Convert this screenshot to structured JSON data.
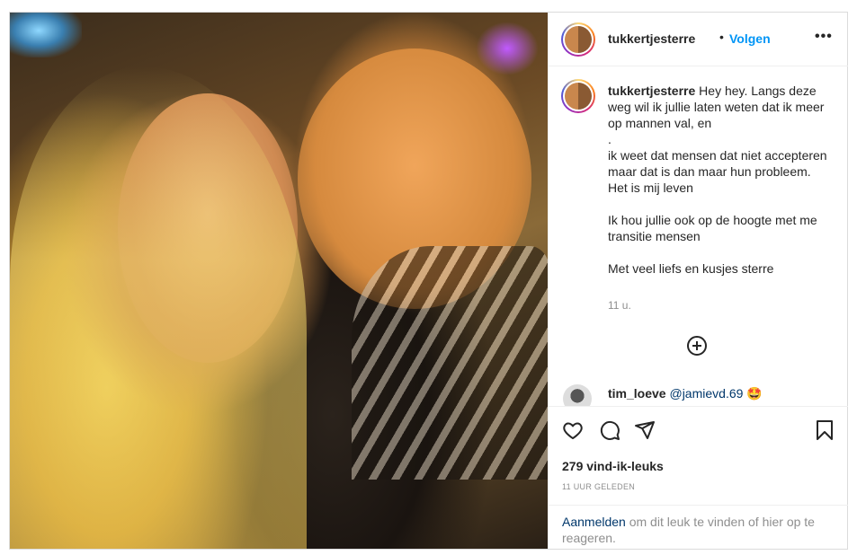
{
  "post": {
    "author": "tukkertjesterre",
    "separator": "•",
    "follow_label": "Volgen",
    "more_label": "•••",
    "caption_user": "tukkertjesterre",
    "caption_text": "Hey hey. Langs deze weg wil ik jullie laten weten dat ik meer op mannen val, en\n.\nik weet dat mensen dat niet accepteren maar dat is dan maar hun probleem.\nHet is mij leven\n\nIk hou jullie ook op de hoogte met me transitie mensen\n\nMet veel liefs en kusjes sterre",
    "caption_time": "11 u.",
    "comment": {
      "user": "tim_loeve",
      "mention": "@jamievd.69",
      "emoji": "🤩"
    },
    "likes": "279 vind-ik-leuks",
    "posted_ago": "11 UUR GELEDEN",
    "login_link": "Aanmelden",
    "login_text": " om dit leuk te vinden of hier op te reageren."
  },
  "colors": {
    "accent": "#0095f6",
    "link": "#00376b",
    "muted": "#8e8e8e",
    "text": "#262626"
  },
  "icons": [
    "heart-icon",
    "comment-icon",
    "share-icon",
    "bookmark-icon",
    "add-comment-icon",
    "more-icon"
  ]
}
